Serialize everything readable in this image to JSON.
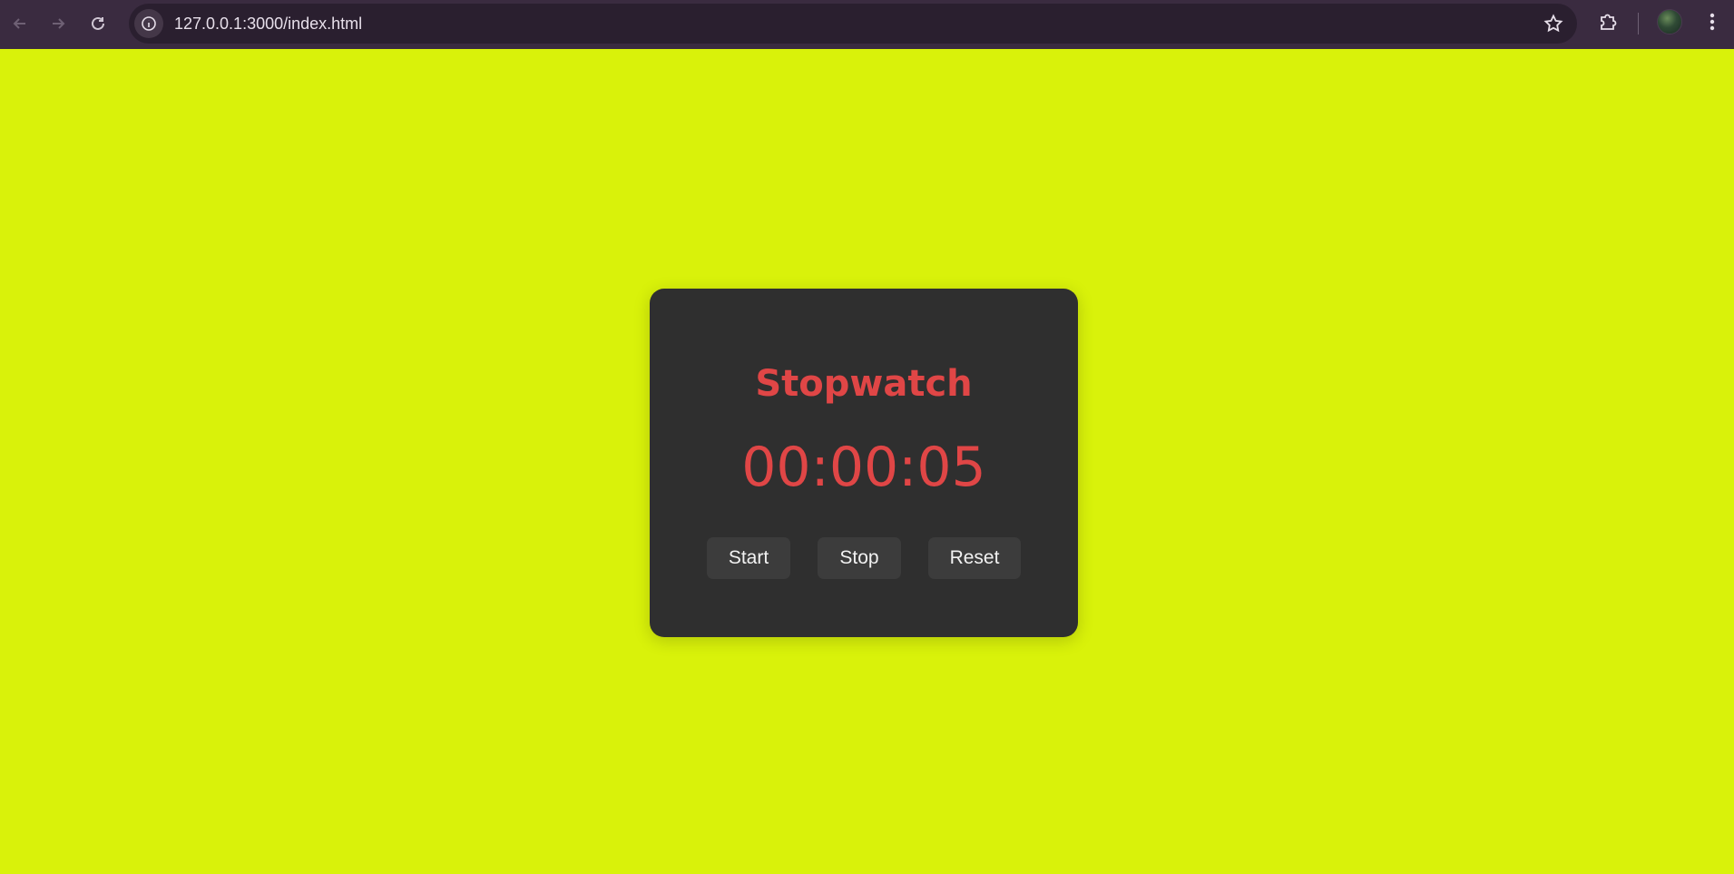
{
  "browser": {
    "url": "127.0.0.1:3000/index.html",
    "icons": {
      "back": "arrow-left-icon",
      "forward": "arrow-right-icon",
      "reload": "reload-icon",
      "site_info": "info-icon",
      "bookmark": "star-icon",
      "extensions": "puzzle-icon",
      "profile": "avatar",
      "menu": "kebab-menu-icon"
    }
  },
  "page": {
    "background_color": "#d9f20a",
    "accent_color": "#e04646"
  },
  "stopwatch": {
    "title": "Stopwatch",
    "time": "00:00:05",
    "buttons": {
      "start": "Start",
      "stop": "Stop",
      "reset": "Reset"
    }
  }
}
